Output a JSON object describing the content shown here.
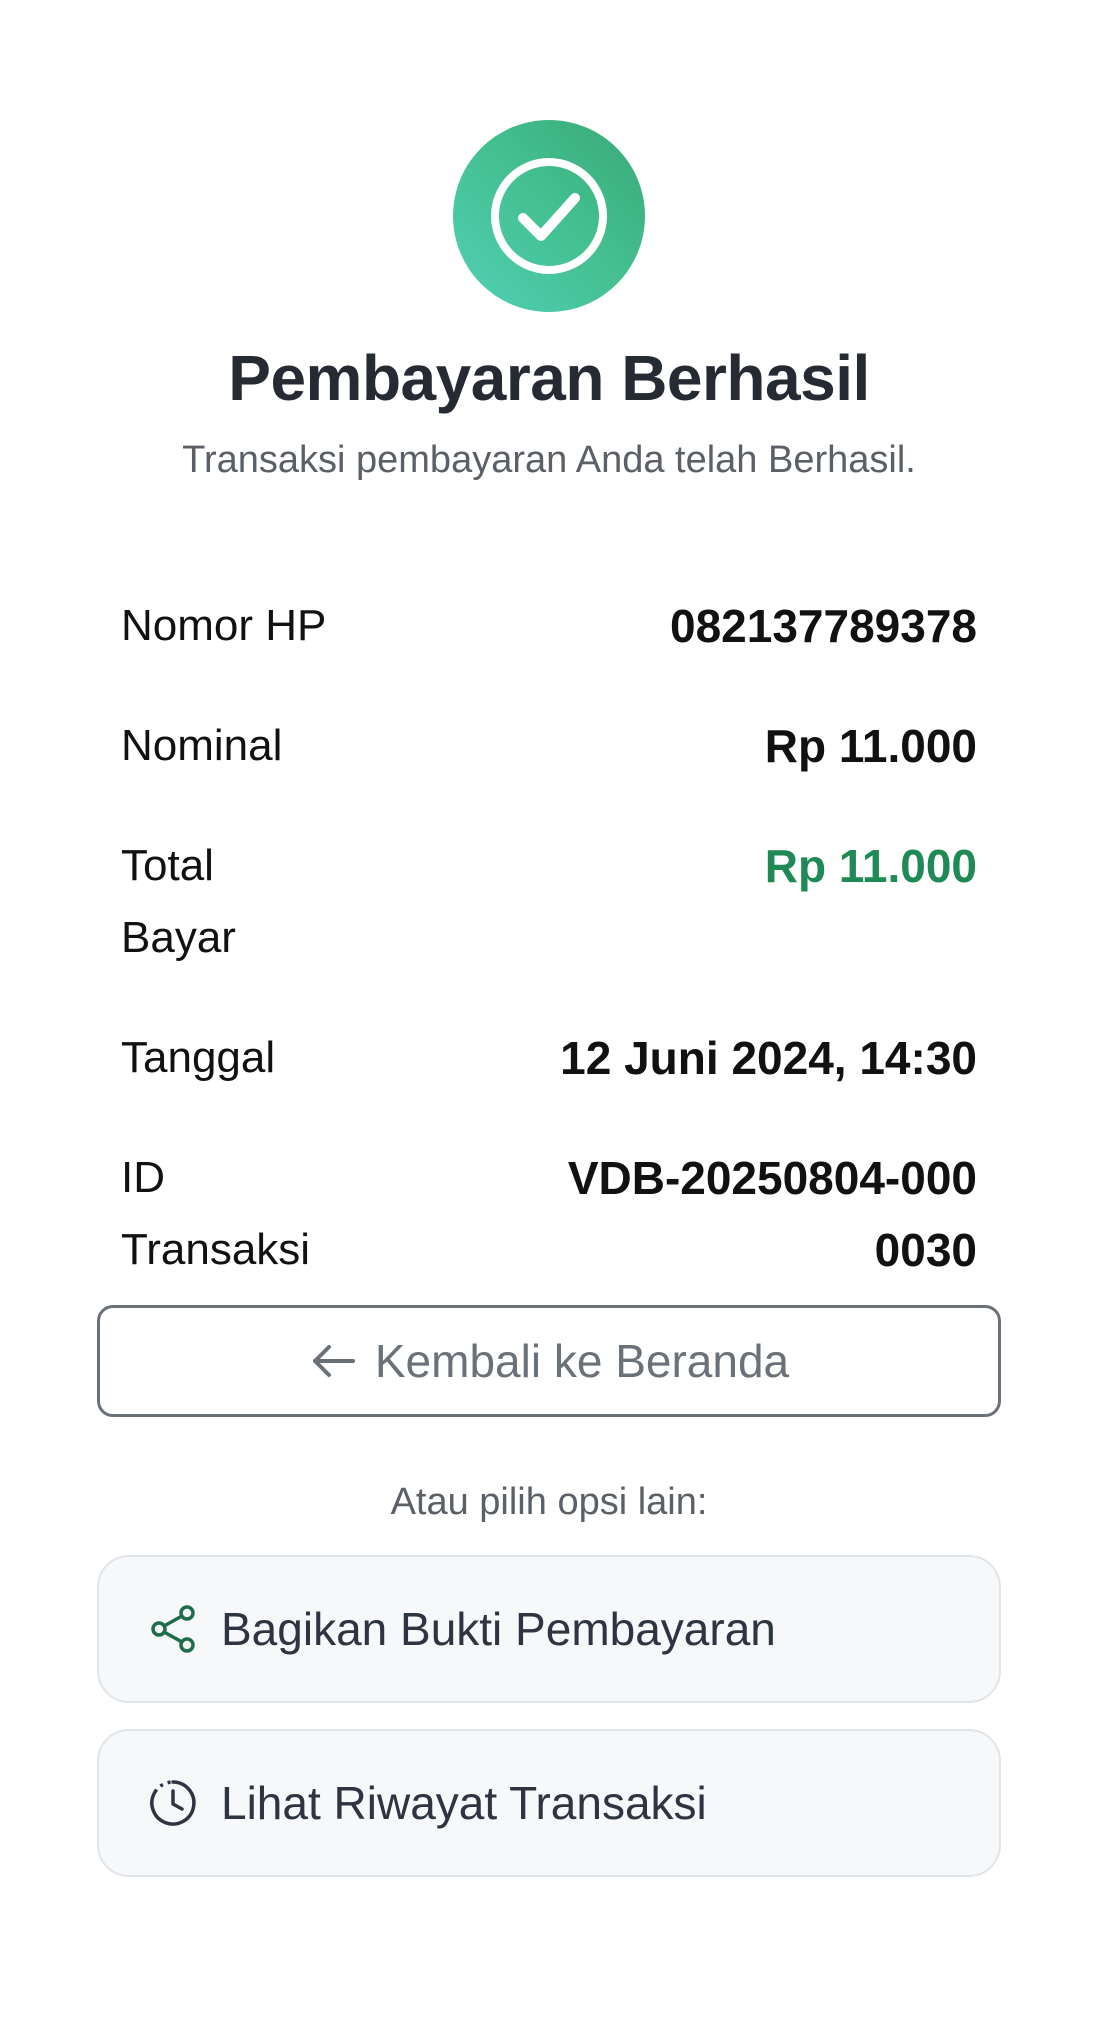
{
  "colors": {
    "success_green": "#1f8a55",
    "badge_gradient_start": "#52d0b6",
    "badge_gradient_end": "#3aa876",
    "title_text": "#262a33",
    "muted_text": "#5b5f66",
    "button_border": "#6b7178",
    "option_bg": "#f6f8fa"
  },
  "header": {
    "icon": "check-circle-icon",
    "title": "Pembayaran Berhasil",
    "subtitle": "Transaksi pembayaran Anda telah Berhasil."
  },
  "details": [
    {
      "label": "Nomor HP",
      "value": "082137789378"
    },
    {
      "label": "Nominal",
      "value": "Rp 11.000"
    },
    {
      "label": "Total Bayar",
      "value": "Rp 11.000"
    },
    {
      "label": "Tanggal",
      "value": "12 Juni 2024, 14:30"
    },
    {
      "label": "ID Transaksi",
      "value": "VDB-20250804-0000030"
    }
  ],
  "actions": {
    "back_label": "Kembali ke Beranda",
    "back_icon": "arrow-left-icon",
    "alt_prompt": "Atau pilih opsi lain:",
    "share_label": "Bagikan Bukti Pembayaran",
    "share_icon": "share-icon",
    "history_label": "Lihat Riwayat Transaksi",
    "history_icon": "history-clock-icon"
  }
}
